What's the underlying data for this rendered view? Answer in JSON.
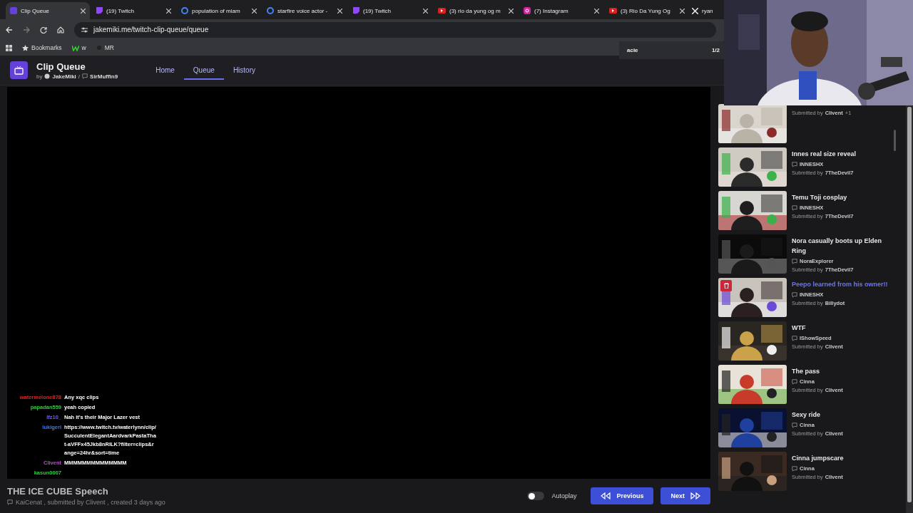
{
  "browser": {
    "tabs": [
      {
        "title": "Clip Queue",
        "kind": "app",
        "selected": true
      },
      {
        "title": "(19) Twitch",
        "kind": "twitch",
        "selected": false
      },
      {
        "title": "population of miam",
        "kind": "google",
        "selected": false
      },
      {
        "title": "starfire voice actor -",
        "kind": "google",
        "selected": false
      },
      {
        "title": "(19) Twitch",
        "kind": "twitch",
        "selected": false
      },
      {
        "title": "(3) rio da yung og m",
        "kind": "youtube",
        "selected": false
      },
      {
        "title": "(7) Instagram",
        "kind": "instagram",
        "selected": false
      },
      {
        "title": "(3) Rio Da Yung Og",
        "kind": "youtube",
        "selected": false
      },
      {
        "title": "ryan",
        "kind": "x",
        "selected": false
      }
    ],
    "address": "jakemiki.me/twitch-clip-queue/queue",
    "bookmarks": [
      {
        "label": "Bookmarks",
        "kind": "star"
      },
      {
        "label": "w",
        "kind": "w"
      },
      {
        "label": "MR",
        "kind": "dot"
      }
    ],
    "find": {
      "query": "acie",
      "count": "1/2"
    }
  },
  "app": {
    "title": "Clip Queue",
    "by": "by",
    "author": "JakeMiki",
    "separator": "/",
    "coauthor": "SirMuffin9",
    "nav": [
      {
        "label": "Home",
        "selected": false
      },
      {
        "label": "Queue",
        "selected": true
      },
      {
        "label": "History",
        "selected": false
      }
    ]
  },
  "chat": [
    {
      "user": "watermelone878",
      "color": "#d42a2a",
      "message": "Any xqc clips"
    },
    {
      "user": "papadan559",
      "color": "#2ecc40",
      "message": "yeah copied"
    },
    {
      "user": "lfz10_",
      "color": "#7b5cf0",
      "message": "Nah it's their Major Lazer vest"
    },
    {
      "user": "lukigeri",
      "color": "#3c7be8",
      "message": "https://www.twitch.tv/waterlynn/clip/SucculentElegantAardvarkPastaThat-aVFFx45Jkb8nRlLK?filter=clips&range=24hr&sort=time"
    },
    {
      "user": "Clivent",
      "color": "#c04ad8",
      "message": "MMMMMMMMMMMMMM"
    },
    {
      "user": "kasun0007",
      "color": "#2ecc40"
    }
  ],
  "current_clip": {
    "title": "THE ICE CUBE Speech",
    "channel": "KaiCenat",
    "submitted_by": ", submitted by",
    "submitter": "Clivent",
    "created": ", created 3 days ago"
  },
  "player": {
    "autoplay": {
      "label": "Autoplay",
      "on": false
    },
    "previous": "Previous",
    "next": "Next"
  },
  "queue": {
    "clips": [
      {
        "submitted_label": "Submitted by",
        "submitter": "Clivent",
        "extra": "+1",
        "hovered": false
      },
      {
        "title": "Innes real size reveal",
        "channel": "INNESHX",
        "submitted_label": "Submitted by",
        "submitter": "7TheDevil7",
        "hovered": false
      },
      {
        "title": "Temu Toji cosplay",
        "channel": "INNESHX",
        "submitted_label": "Submitted by",
        "submitter": "7TheDevil7",
        "hovered": false
      },
      {
        "title": "Nora casually boots up Elden Ring",
        "channel": "NoraExplorer",
        "submitted_label": "Submitted by",
        "submitter": "7TheDevil7",
        "hovered": false
      },
      {
        "title": "Peepo learned from his owner!!",
        "channel": "INNESHX",
        "submitted_label": "Submitted by",
        "submitter": "Billydot",
        "hovered": true
      },
      {
        "title": "WTF",
        "channel": "IShowSpeed",
        "submitted_label": "Submitted by",
        "submitter": "Clivent",
        "hovered": false
      },
      {
        "title": "The pass",
        "channel": "Cinna",
        "submitted_label": "Submitted by",
        "submitter": "Clivent",
        "hovered": false
      },
      {
        "title": "Sexy ride",
        "channel": "Cinna",
        "submitted_label": "Submitted by",
        "submitter": "Clivent",
        "hovered": false
      },
      {
        "title": "Cinna jumpscare",
        "channel": "Cinna",
        "submitted_label": "Submitted by",
        "submitter": "Clivent",
        "hovered": false
      }
    ]
  }
}
